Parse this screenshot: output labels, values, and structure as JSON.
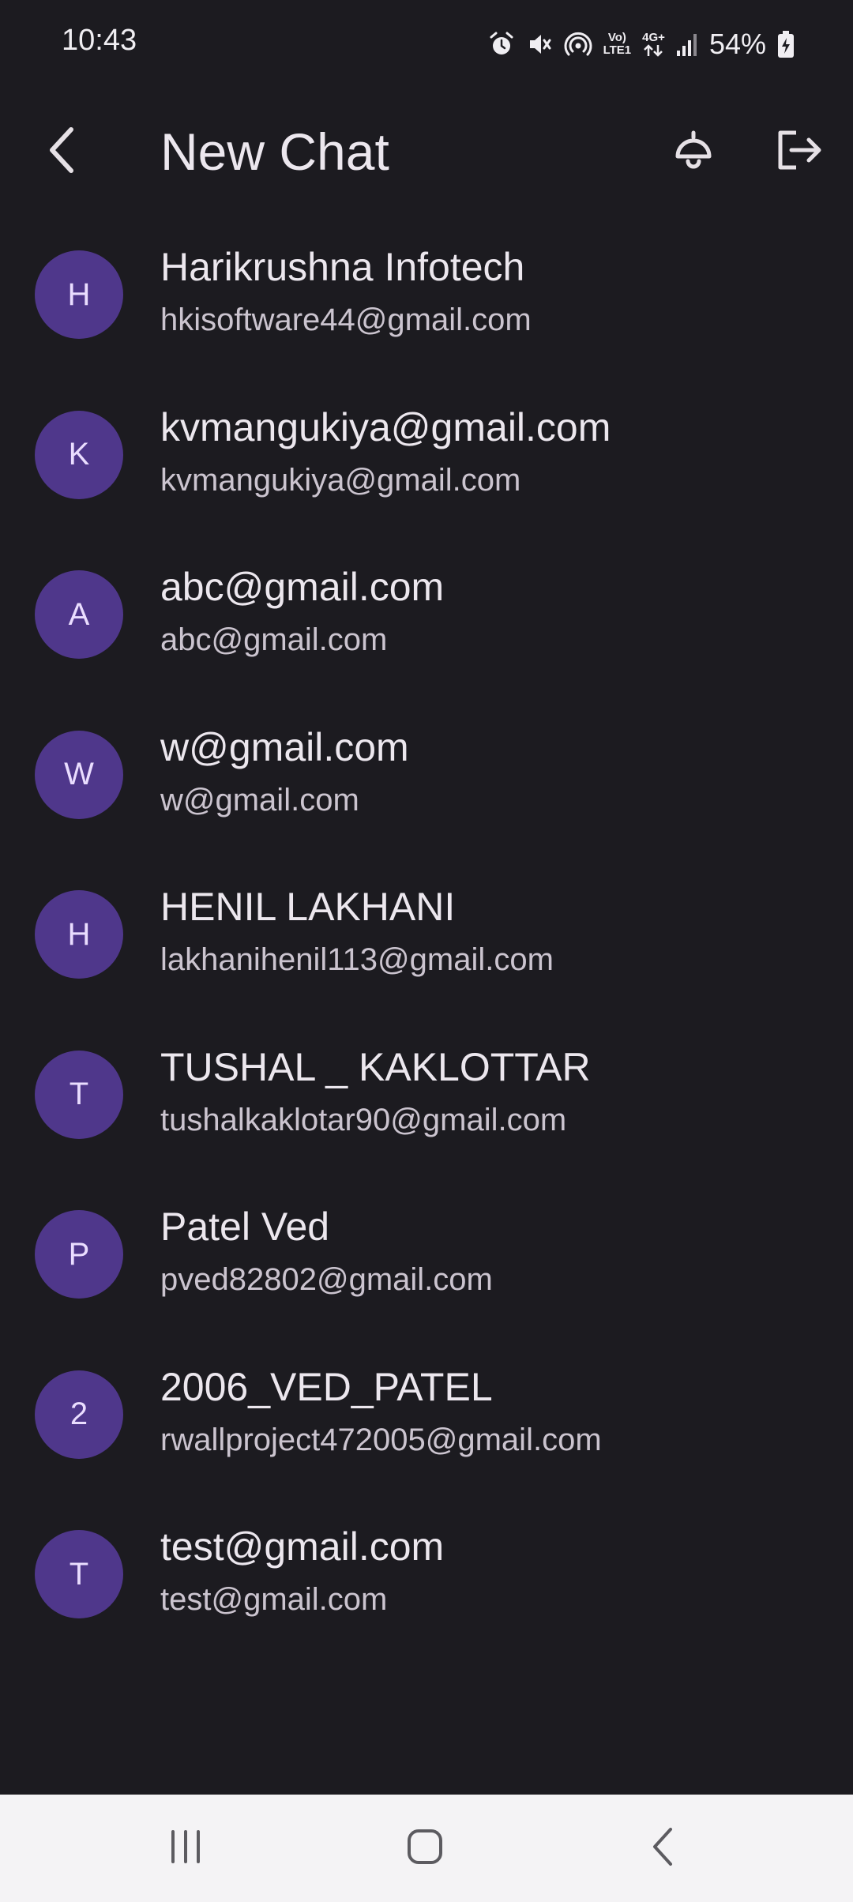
{
  "status_bar": {
    "time": "10:43",
    "network_top": "Vo)",
    "network_bottom": "LTE1",
    "data_type": "4G+",
    "battery_percent": "54%",
    "icons": [
      "alarm-icon",
      "mute-icon",
      "hotspot-icon",
      "volte-icon",
      "data-arrows-icon",
      "signal-icon",
      "battery-charging-icon"
    ]
  },
  "app_bar": {
    "title": "New Chat",
    "back_icon": "back-arrow-icon",
    "bell_icon": "bell-icon",
    "logout_icon": "logout-icon"
  },
  "contacts": [
    {
      "initial": "H",
      "name": "Harikrushna Infotech",
      "email": "hkisoftware44@gmail.com"
    },
    {
      "initial": "K",
      "name": "kvmangukiya@gmail.com",
      "email": "kvmangukiya@gmail.com"
    },
    {
      "initial": "A",
      "name": "abc@gmail.com",
      "email": "abc@gmail.com"
    },
    {
      "initial": "W",
      "name": "w@gmail.com",
      "email": "w@gmail.com"
    },
    {
      "initial": "H",
      "name": "HENIL LAKHANI",
      "email": "lakhanihenil113@gmail.com"
    },
    {
      "initial": "T",
      "name": "TUSHAL _ KAKLOTTAR",
      "email": "tushalkaklotar90@gmail.com"
    },
    {
      "initial": "P",
      "name": "Patel Ved",
      "email": "pved82802@gmail.com"
    },
    {
      "initial": "2",
      "name": "2006_VED_PATEL",
      "email": "rwallproject472005@gmail.com"
    },
    {
      "initial": "T",
      "name": "test@gmail.com",
      "email": "test@gmail.com"
    }
  ],
  "colors": {
    "background": "#1c1b20",
    "avatar_bg": "#4f378b",
    "avatar_text": "#eaddff",
    "primary_text": "#ece7ee",
    "secondary_text": "#cbc4cf",
    "nav_bar_bg": "#f4f3f5"
  },
  "nav_bar": {
    "icons": [
      "recent-apps-icon",
      "home-icon",
      "back-nav-icon"
    ]
  }
}
